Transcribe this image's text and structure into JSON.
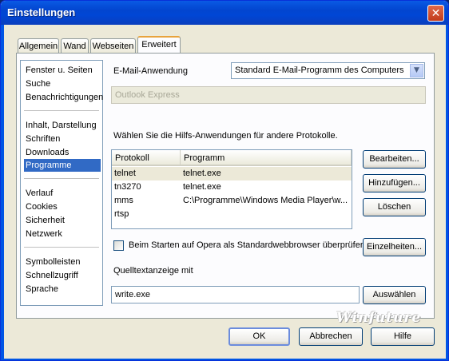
{
  "window": {
    "title": "Einstellungen",
    "close_glyph": "✕"
  },
  "tabs": [
    {
      "label": "Allgemein"
    },
    {
      "label": "Wand"
    },
    {
      "label": "Webseiten"
    },
    {
      "label": "Erweitert",
      "active": true
    }
  ],
  "categories": {
    "group1": [
      "Fenster u. Seiten",
      "Suche",
      "Benachrichtigungen"
    ],
    "group2": [
      "Inhalt, Darstellung",
      "Schriften",
      "Downloads",
      "Programme"
    ],
    "group3": [
      "Verlauf",
      "Cookies",
      "Sicherheit",
      "Netzwerk"
    ],
    "group4": [
      "Symbolleisten",
      "Schnellzugriff",
      "Sprache"
    ],
    "selected": "Programme"
  },
  "email": {
    "label": "E-Mail-Anwendung",
    "selected": "Standard E-Mail-Programm des Computers",
    "client": "Outlook Express"
  },
  "protocols": {
    "intro": "Wählen Sie die Hilfs-Anwendungen für andere Protokolle.",
    "columns": [
      "Protokoll",
      "Programm"
    ],
    "rows": [
      {
        "protocol": "telnet",
        "program": "telnet.exe"
      },
      {
        "protocol": "tn3270",
        "program": "telnet.exe"
      },
      {
        "protocol": "mms",
        "program": "C:\\Programme\\Windows Media Player\\w..."
      },
      {
        "protocol": "rtsp",
        "program": ""
      }
    ],
    "buttons": {
      "edit": "Bearbeiten...",
      "add": "Hinzufügen...",
      "delete": "Löschen"
    }
  },
  "default_browser": {
    "label": "Beim Starten auf Opera als Standardwebbrowser überprüfen",
    "checked": false,
    "details_button": "Einzelheiten..."
  },
  "source_viewer": {
    "label": "Quelltextanzeige mit",
    "value": "write.exe",
    "choose_button": "Auswählen"
  },
  "dialog_buttons": {
    "ok": "OK",
    "cancel": "Abbrechen",
    "help": "Hilfe"
  },
  "watermark": "Winfuture"
}
